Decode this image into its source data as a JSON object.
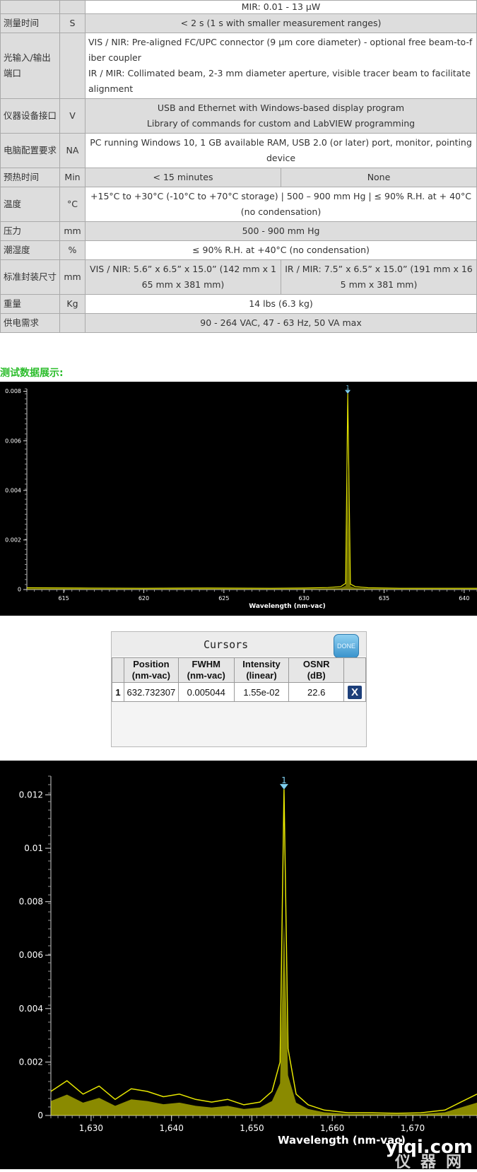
{
  "spec_rows": [
    {
      "name": "",
      "unit": "",
      "cells": [
        "MIR: 0.01 - 13 μW"
      ]
    },
    {
      "name": "测量时间",
      "unit": "S",
      "cells": [
        "< 2 s (1 s with smaller measurement ranges)"
      ]
    },
    {
      "name": "光输入/输出端口",
      "unit": "",
      "cells": [
        "VIS / NIR: Pre-aligned FC/UPC   connector (9 µm core diameter) - optional free beam-to-fiber coupler",
        "IR / MIR: Collimated beam, 2-3 mm   diameter aperture, visible tracer beam to facilitate alignment"
      ]
    },
    {
      "name": "仪器设备接口",
      "unit": "V",
      "cells": [
        "USB and Ethernet with Windows-based display program",
        "Library of commands for custom and LabVIEW programming"
      ]
    },
    {
      "name": "电脑配置要求",
      "unit": "NA",
      "cells": [
        "PC running Windows 10, 1 GB available RAM, USB 2.0 (or later) port, monitor, pointing device"
      ]
    },
    {
      "name": "预热时间",
      "unit": "Min",
      "cells": [
        "< 15 minutes",
        "None"
      ]
    },
    {
      "name": "温度",
      "unit": "°C",
      "cells": [
        "+15°C to +30°C (-10°C to +70°C storage) | 500 – 900 mm Hg | ≤ 90% R.H. at + 40°C (no condensation)"
      ]
    },
    {
      "name": "压力",
      "unit": "mm",
      "cells": [
        "500 - 900 mm Hg"
      ]
    },
    {
      "name": "潮湿度",
      "unit": "%",
      "cells": [
        "≤ 90% R.H. at   +40°C (no condensation)"
      ]
    },
    {
      "name": "标准封装尺寸",
      "unit": "mm",
      "cells": [
        "VIS / NIR: 5.6” x 6.5” x 15.0” (142 mm x 165 mm x 381 mm)",
        "IR / MIR: 7.5” x 6.5” x 15.0” (191 mm x 165 mm x 381 mm)"
      ]
    },
    {
      "name": "重量",
      "unit": "Kg",
      "cells": [
        "14 lbs (6.3 kg)"
      ]
    },
    {
      "name": "供电需求",
      "unit": "",
      "cells": [
        "90 - 264 VAC, 47 - 63 Hz, 50 VA max"
      ]
    }
  ],
  "section_title": "测试数据展示:",
  "cursors": {
    "title": "Cursors",
    "done_label": "DONE",
    "headers": [
      [
        "Position",
        "(nm-vac)"
      ],
      [
        "FWHM",
        "(nm-vac)"
      ],
      [
        "Intensity",
        "(linear)"
      ],
      [
        "OSNR",
        "(dB)"
      ]
    ],
    "row": {
      "index": "1",
      "position": "632.732307",
      "fwhm": "0.005044",
      "intensity": "1.55e-02",
      "osnr": "22.6",
      "delete": "X"
    }
  },
  "watermark": {
    "brand": "yiqi.com",
    "cn": "仪器网"
  },
  "chart_data": [
    {
      "type": "line",
      "xlabel": "Wavelength (nm-vac)",
      "ylabel": "",
      "xlim": [
        612.7,
        640.8
      ],
      "ylim": [
        0,
        0.0081
      ],
      "x_ticks": [
        615,
        620,
        625,
        630,
        635,
        640
      ],
      "x_tick_labels": [
        "615",
        "620",
        "625",
        "630",
        "635",
        "640"
      ],
      "y_ticks": [
        0,
        0.002,
        0.004,
        0.006,
        0.008
      ],
      "y_tick_labels": [
        "0",
        "0.002",
        "0.004",
        "0.006",
        "0.008"
      ],
      "cursor_label": "1",
      "peak_x": 632.73,
      "peak_y": 0.0079,
      "x": [
        612.7,
        616,
        620,
        624,
        628,
        630,
        631.5,
        632.3,
        632.6,
        632.73,
        632.9,
        633.2,
        634,
        636,
        638,
        640.8
      ],
      "y": [
        7e-05,
        6e-05,
        5e-05,
        6e-05,
        5e-05,
        6e-05,
        8e-05,
        0.00012,
        0.00025,
        0.0079,
        0.00022,
        0.00012,
        7e-05,
        5e-05,
        5e-05,
        5e-05
      ],
      "color": "#e6e600",
      "grid": false
    },
    {
      "type": "line",
      "xlabel": "Wavelength (nm-vac)",
      "ylabel": "",
      "xlim": [
        1625,
        1678
      ],
      "ylim": [
        0,
        0.0127
      ],
      "x_ticks": [
        1630,
        1640,
        1650,
        1660,
        1670
      ],
      "x_tick_labels": [
        "1,630",
        "1,640",
        "1,650",
        "1,660",
        "1,670"
      ],
      "y_ticks": [
        0,
        0.002,
        0.004,
        0.006,
        0.008,
        0.01,
        0.012
      ],
      "y_tick_labels": [
        "0",
        "0.002",
        "0.004",
        "0.006",
        "0.008",
        "0.01",
        "0.012"
      ],
      "cursor_label": "1",
      "peak_x": 1654,
      "peak_y": 0.0122,
      "x": [
        1625,
        1627,
        1629,
        1631,
        1633,
        1635,
        1637,
        1639,
        1641,
        1643,
        1645,
        1647,
        1649,
        1651,
        1652.5,
        1653.5,
        1654,
        1654.5,
        1655.5,
        1657,
        1659,
        1662,
        1665,
        1668,
        1671,
        1674,
        1676,
        1678
      ],
      "y": [
        0.0009,
        0.0013,
        0.0008,
        0.0011,
        0.0006,
        0.001,
        0.0009,
        0.0007,
        0.0008,
        0.0006,
        0.0005,
        0.0006,
        0.0004,
        0.0005,
        0.0009,
        0.002,
        0.0122,
        0.0025,
        0.0008,
        0.0004,
        0.0002,
        0.0001,
        0.0001,
        8e-05,
        0.0001,
        0.0002,
        0.0005,
        0.0008
      ],
      "color": "#e6e600",
      "grid": false
    }
  ]
}
